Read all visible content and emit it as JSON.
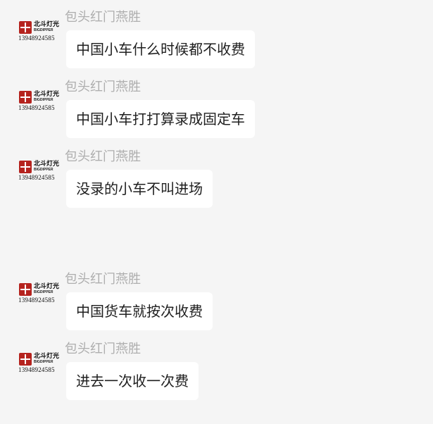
{
  "avatar": {
    "brand_cn": "北斗灯光",
    "brand_en": "BIGDIPPER",
    "phone": "13948924585"
  },
  "messages": [
    {
      "sender": "包头红门燕胜",
      "text": "中国小车什么时候都不收费"
    },
    {
      "sender": "包头红门燕胜",
      "text": "中国小车打打算录成固定车"
    },
    {
      "sender": "包头红门燕胜",
      "text": "没录的小车不叫进场"
    },
    {
      "sender": "包头红门燕胜",
      "text": "中国货车就按次收费"
    },
    {
      "sender": "包头红门燕胜",
      "text": "进去一次收一次费"
    }
  ],
  "colors": {
    "background": "#f5f5f5",
    "bubble": "#ffffff",
    "sender_name": "#aeaeae",
    "message_text": "#1f1f1f",
    "logo_red": "#b5231e"
  }
}
